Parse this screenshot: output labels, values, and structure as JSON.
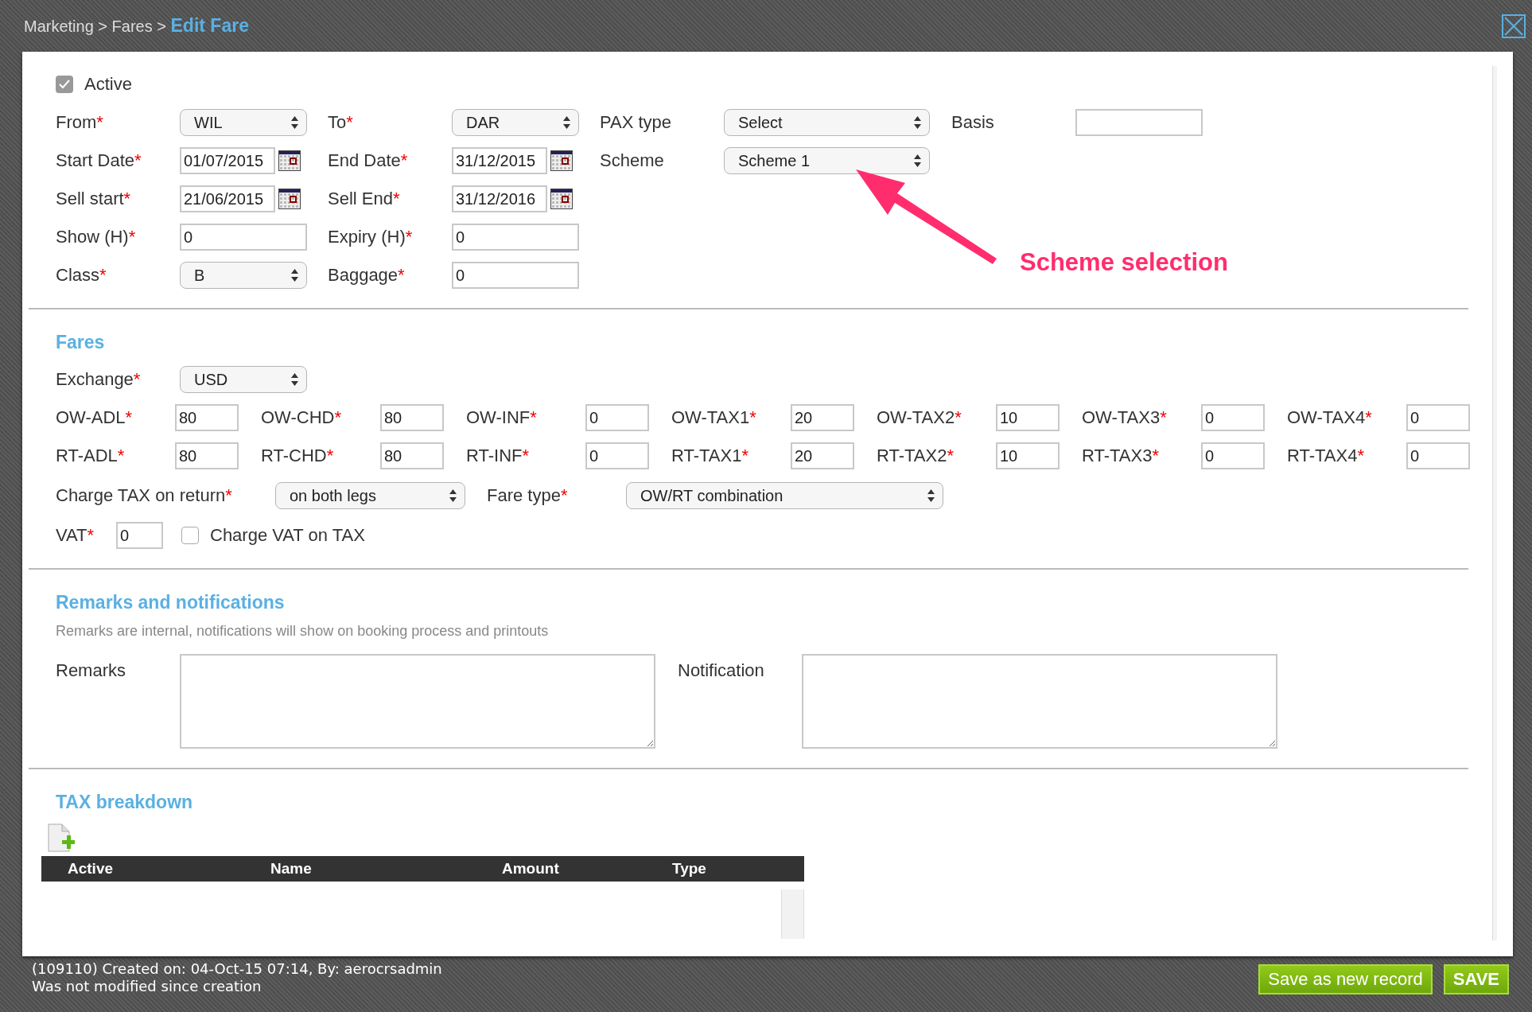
{
  "breadcrumb": {
    "path": "Marketing > Fares >",
    "current": "Edit Fare"
  },
  "active": {
    "label": "Active",
    "checked": true
  },
  "general_rows": [
    [
      {
        "label": "From",
        "asterisk": "*",
        "kind": "select",
        "value": "WIL"
      },
      {
        "label": "To",
        "asterisk": "*",
        "kind": "select",
        "value": "DAR"
      },
      {
        "label": "PAX type",
        "kind": "select",
        "value": "Select"
      },
      {
        "label": "Basis",
        "kind": "text"
      }
    ],
    [
      {
        "label": "Start Date",
        "asterisk": "*",
        "kind": "date",
        "value": "01/07/2015"
      },
      {
        "label": "End Date",
        "asterisk": "*",
        "kind": "date",
        "value": "31/12/2015"
      },
      {
        "label": "Scheme",
        "kind": "select",
        "value": "Scheme 1"
      }
    ],
    [
      {
        "label": "Sell start",
        "asterisk": "*",
        "kind": "date",
        "value": "21/06/2015"
      },
      {
        "label": "Sell End",
        "asterisk": "*",
        "kind": "date",
        "value": "31/12/2016"
      }
    ],
    [
      {
        "label": "Show (H)",
        "asterisk": "*",
        "kind": "text",
        "value": "0"
      },
      {
        "label": "Expiry (H)",
        "asterisk": "*",
        "kind": "text",
        "value": "0"
      }
    ],
    [
      {
        "label": "Class",
        "asterisk": "*",
        "kind": "select",
        "value": "B"
      },
      {
        "label": "Baggage",
        "asterisk": "*",
        "kind": "text",
        "value": "0"
      }
    ]
  ],
  "annotation": {
    "text": "Scheme selection"
  },
  "fares": {
    "title": "Fares",
    "exchange": {
      "label": "Exchange",
      "asterisk": "*",
      "value": "USD"
    },
    "rows": [
      [
        {
          "label": "OW-ADL",
          "asterisk": "*",
          "value": "80"
        },
        {
          "label": "OW-CHD",
          "asterisk": "*",
          "value": "80"
        },
        {
          "label": "OW-INF",
          "asterisk": "*",
          "value": "0"
        },
        {
          "label": "OW-TAX1",
          "asterisk": "*",
          "value": "20"
        },
        {
          "label": "OW-TAX2",
          "asterisk": "*",
          "value": "10"
        },
        {
          "label": "OW-TAX3",
          "asterisk": "*",
          "value": "0"
        },
        {
          "label": "OW-TAX4",
          "asterisk": "*",
          "value": "0"
        }
      ],
      [
        {
          "label": "RT-ADL",
          "asterisk": "*",
          "value": "80"
        },
        {
          "label": "RT-CHD",
          "asterisk": "*",
          "value": "80"
        },
        {
          "label": "RT-INF",
          "asterisk": "*",
          "value": "0"
        },
        {
          "label": "RT-TAX1",
          "asterisk": "*",
          "value": "20"
        },
        {
          "label": "RT-TAX2",
          "asterisk": "*",
          "value": "10"
        },
        {
          "label": "RT-TAX3",
          "asterisk": "*",
          "value": "0"
        },
        {
          "label": "RT-TAX4",
          "asterisk": "*",
          "value": "0"
        }
      ]
    ],
    "charge_tax": {
      "label": "Charge TAX on return",
      "asterisk": "*",
      "value": "on both legs"
    },
    "fare_type": {
      "label": "Fare type",
      "asterisk": "*",
      "value": "OW/RT combination"
    },
    "vat": {
      "label": "VAT",
      "asterisk": "*",
      "value": "0"
    },
    "charge_vat": {
      "label": "Charge VAT on TAX",
      "checked": false
    }
  },
  "remarks": {
    "title": "Remarks and notifications",
    "subtitle": "Remarks are internal, notifications will show on booking process and printouts",
    "remarks_label": "Remarks",
    "notification_label": "Notification"
  },
  "tax_breakdown": {
    "title": "TAX breakdown",
    "columns": [
      "Active",
      "Name",
      "Amount",
      "Type"
    ]
  },
  "footer": {
    "lines": [
      "(109110) Created on: 04-Oct-15 07:14, By: aerocrsadmin",
      "Was not modified since creation"
    ],
    "buttons": [
      "Save as new record",
      "SAVE"
    ]
  }
}
